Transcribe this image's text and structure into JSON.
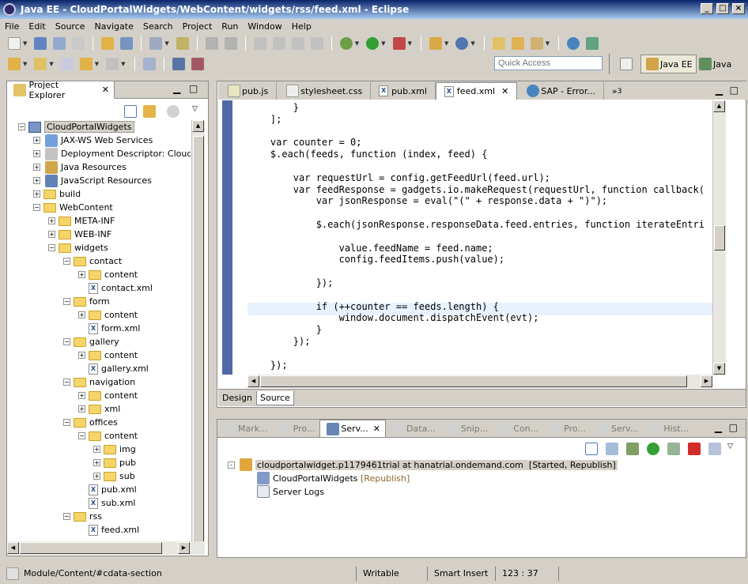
{
  "window": {
    "title": "Java EE - CloudPortalWidgets/WebContent/widgets/rss/feed.xml - Eclipse"
  },
  "menu": [
    "File",
    "Edit",
    "Source",
    "Navigate",
    "Search",
    "Project",
    "Run",
    "Window",
    "Help"
  ],
  "quick_access": {
    "placeholder": "Quick Access"
  },
  "perspectives": [
    {
      "label": "Java EE",
      "active": true
    },
    {
      "label": "Java",
      "active": false
    }
  ],
  "project_explorer": {
    "title": "Project Explorer",
    "tree": [
      {
        "label": "CloudPortalWidgets",
        "depth": 0,
        "icon": "project",
        "exp": "-",
        "selected": true
      },
      {
        "label": "JAX-WS Web Services",
        "depth": 1,
        "icon": "ws",
        "exp": "+"
      },
      {
        "label": "Deployment Descriptor: CloudPort",
        "depth": 1,
        "icon": "dd",
        "exp": "+"
      },
      {
        "label": "Java Resources",
        "depth": 1,
        "icon": "java",
        "exp": "+"
      },
      {
        "label": "JavaScript Resources",
        "depth": 1,
        "icon": "js",
        "exp": "+"
      },
      {
        "label": "build",
        "depth": 1,
        "icon": "folder",
        "exp": "+"
      },
      {
        "label": "WebContent",
        "depth": 1,
        "icon": "folder",
        "exp": "-"
      },
      {
        "label": "META-INF",
        "depth": 2,
        "icon": "folder",
        "exp": "+"
      },
      {
        "label": "WEB-INF",
        "depth": 2,
        "icon": "folder",
        "exp": "+"
      },
      {
        "label": "widgets",
        "depth": 2,
        "icon": "folder",
        "exp": "-"
      },
      {
        "label": "contact",
        "depth": 3,
        "icon": "folder",
        "exp": "-"
      },
      {
        "label": "content",
        "depth": 4,
        "icon": "folder",
        "exp": "+"
      },
      {
        "label": "contact.xml",
        "depth": 4,
        "icon": "xml",
        "exp": ""
      },
      {
        "label": "form",
        "depth": 3,
        "icon": "folder",
        "exp": "-"
      },
      {
        "label": "content",
        "depth": 4,
        "icon": "folder",
        "exp": "+"
      },
      {
        "label": "form.xml",
        "depth": 4,
        "icon": "xml",
        "exp": ""
      },
      {
        "label": "gallery",
        "depth": 3,
        "icon": "folder",
        "exp": "-"
      },
      {
        "label": "content",
        "depth": 4,
        "icon": "folder",
        "exp": "+"
      },
      {
        "label": "gallery.xml",
        "depth": 4,
        "icon": "xml",
        "exp": ""
      },
      {
        "label": "navigation",
        "depth": 3,
        "icon": "folder",
        "exp": "-"
      },
      {
        "label": "content",
        "depth": 4,
        "icon": "folder",
        "exp": "+"
      },
      {
        "label": "xml",
        "depth": 4,
        "icon": "folder",
        "exp": "+"
      },
      {
        "label": "offices",
        "depth": 3,
        "icon": "folder",
        "exp": "-"
      },
      {
        "label": "content",
        "depth": 4,
        "icon": "folder",
        "exp": "-"
      },
      {
        "label": "img",
        "depth": 5,
        "icon": "folder",
        "exp": "+"
      },
      {
        "label": "pub",
        "depth": 5,
        "icon": "folder",
        "exp": "+"
      },
      {
        "label": "sub",
        "depth": 5,
        "icon": "folder",
        "exp": "+"
      },
      {
        "label": "pub.xml",
        "depth": 4,
        "icon": "xml",
        "exp": ""
      },
      {
        "label": "sub.xml",
        "depth": 4,
        "icon": "xml",
        "exp": ""
      },
      {
        "label": "rss",
        "depth": 3,
        "icon": "folder",
        "exp": "-"
      },
      {
        "label": "feed.xml",
        "depth": 4,
        "icon": "xml",
        "exp": ""
      }
    ]
  },
  "editor": {
    "tabs": [
      {
        "label": "pub.js",
        "icon": "js"
      },
      {
        "label": "stylesheet.css",
        "icon": "css"
      },
      {
        "label": "pub.xml",
        "icon": "xml"
      },
      {
        "label": "feed.xml",
        "icon": "xml",
        "active": true
      },
      {
        "label": "SAP - Error...",
        "icon": "web"
      }
    ],
    "overflow": "»",
    "overflow_count": "3",
    "code": [
      "        }",
      "    ];",
      "",
      "    var counter = 0;",
      "    $.each(feeds, function (index, feed) {",
      "",
      "        var requestUrl = config.getFeedUrl(feed.url);",
      "        var feedResponse = gadgets.io.makeRequest(requestUrl, function callback(",
      "            var jsonResponse = eval(\"(\" + response.data + \")\");",
      "",
      "            $.each(jsonResponse.responseData.feed.entries, function iterateEntri",
      "",
      "                value.feedName = feed.name;",
      "                config.feedItems.push(value);",
      "",
      "            });",
      "",
      "            if (++counter == feeds.length) {",
      "                window.document.dispatchEvent(evt);",
      "            }",
      "        });",
      "",
      "    });"
    ],
    "highlight_line": 17,
    "bottom_tabs": [
      {
        "label": "Design"
      },
      {
        "label": "Source",
        "active": true
      }
    ]
  },
  "servers_view": {
    "tabs": [
      {
        "label": "Mark...",
        "icon": "markers"
      },
      {
        "label": "Pro...",
        "icon": "properties"
      },
      {
        "label": "Serv...",
        "icon": "servers",
        "active": true
      },
      {
        "label": "Data...",
        "icon": "data"
      },
      {
        "label": "Snip...",
        "icon": "snippets"
      },
      {
        "label": "Con...",
        "icon": "console"
      },
      {
        "label": "Pro...",
        "icon": "progress"
      },
      {
        "label": "Serv...",
        "icon": "servers"
      },
      {
        "label": "Hist...",
        "icon": "history"
      }
    ],
    "server": {
      "name": "cloudportalwidget.p1179461trial at hanatrial.ondemand.com",
      "state": "[Started, Republish]"
    },
    "children": [
      {
        "label": "CloudPortalWidgets",
        "state": "[Republish]"
      },
      {
        "label": "Server Logs",
        "state": ""
      }
    ]
  },
  "status_bar": {
    "path": "Module/Content/#cdata-section",
    "mode": "Writable",
    "insert": "Smart Insert",
    "position": "123 : 37"
  },
  "colors": {
    "title_from": "#0a246a",
    "title_to": "#a6caf0",
    "chrome": "#d4d0c8",
    "highlight": "#e8f2fe",
    "selected": "#d4d0c8"
  }
}
